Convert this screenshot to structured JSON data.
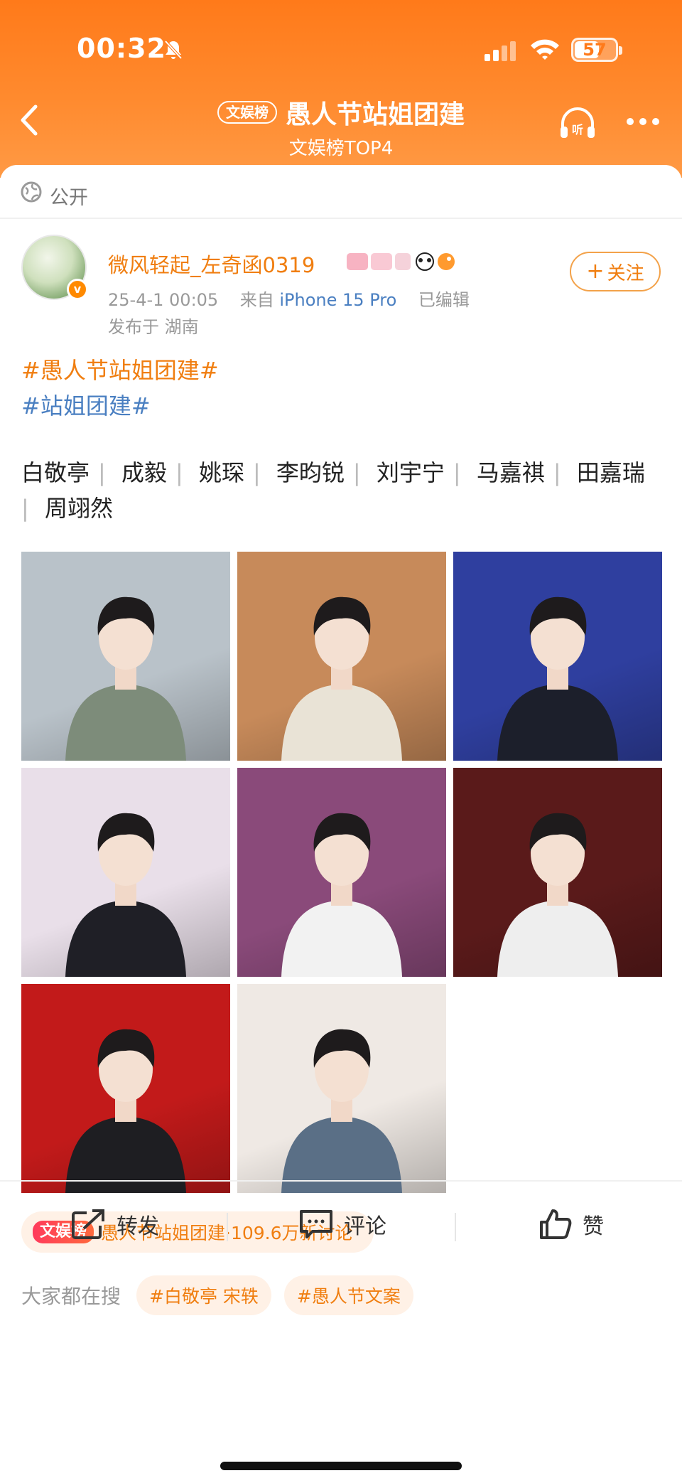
{
  "status_bar": {
    "time": "00:32",
    "battery": "57"
  },
  "nav": {
    "rank_tag": "文娱榜",
    "title": "愚人节站姐团建",
    "subtitle": "文娱榜TOP4"
  },
  "visibility": {
    "label": "公开"
  },
  "post": {
    "username": "微风轻起_左奇函0319",
    "timestamp": "25-4-1 00:05",
    "from_label": "来自",
    "device": "iPhone 15 Pro",
    "edited": "已编辑",
    "location": "发布于 湖南",
    "follow_label": "关注",
    "hashtag1": "#愚人节站姐团建#",
    "hashtag2": "#站姐团建#",
    "names": [
      "白敬亭",
      "成毅",
      "姚琛",
      "李昀锐",
      "刘宇宁",
      "马嘉祺",
      "田嘉瑞",
      "周翊然"
    ]
  },
  "photos": [
    {
      "bg": "#b9c2c9",
      "accent": "#7d8c7a"
    },
    {
      "bg": "#c78a5a",
      "accent": "#e9e3d6"
    },
    {
      "bg": "#2f3f9f",
      "accent": "#1c1f2b"
    },
    {
      "bg": "#e9dfe9",
      "accent": "#1f1f26"
    },
    {
      "bg": "#8a4a7a",
      "accent": "#f2f2f2"
    },
    {
      "bg": "#5a1a1a",
      "accent": "#eeeeee"
    },
    {
      "bg": "#c21a1a",
      "accent": "#1e1e22"
    },
    {
      "bg": "#efe9e4",
      "accent": "#5a6f86"
    }
  ],
  "topic": {
    "tag": "文娱榜",
    "text": "愚人节站姐团建·109.6万新讨论"
  },
  "search": {
    "label": "大家都在搜",
    "chips": [
      "#白敬亭 宋轶",
      "#愚人节文案"
    ]
  },
  "actions": {
    "repost": "转发",
    "comment": "评论",
    "like": "赞"
  },
  "colors": {
    "brand_orange": "#ff7a1a",
    "link_blue": "#4a7fc1",
    "tag_orange": "#f07e10"
  }
}
